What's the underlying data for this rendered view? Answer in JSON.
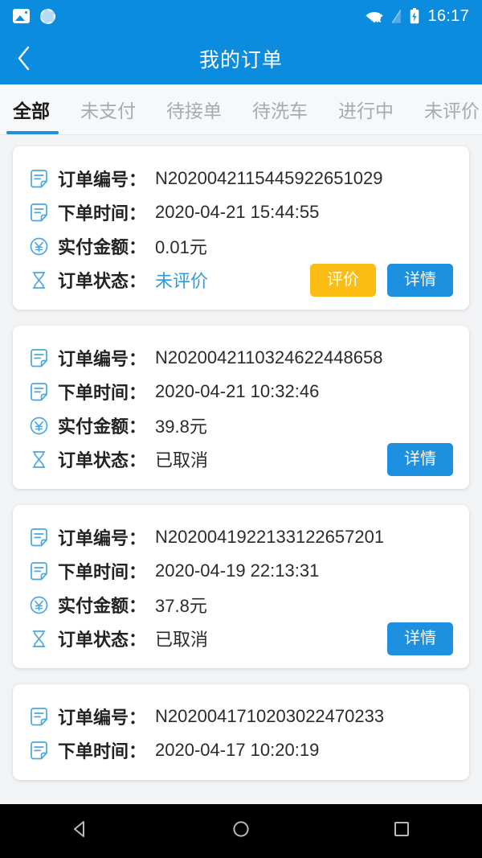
{
  "statusbar": {
    "time": "16:17",
    "icons": [
      "photo-icon",
      "sync-icon",
      "wifi-disconnected-icon",
      "sim-card-icon",
      "battery-charging-icon"
    ]
  },
  "header": {
    "title": "我的订单",
    "back_icon": "chevron-left-icon",
    "background": "#0c8cdf"
  },
  "tabs": [
    {
      "label": "全部",
      "active": true
    },
    {
      "label": "未支付",
      "active": false
    },
    {
      "label": "待接单",
      "active": false
    },
    {
      "label": "待洗车",
      "active": false
    },
    {
      "label": "进行中",
      "active": false
    },
    {
      "label": "未评价",
      "active": false
    }
  ],
  "labels": {
    "order_no": "订单编号：",
    "order_time": "下单时间：",
    "paid_amount": "实付金额：",
    "order_status": "订单状态："
  },
  "buttons": {
    "review": "评价",
    "detail": "详情",
    "review_color": "#fbbd14",
    "detail_color": "#1e90e0"
  },
  "orders": [
    {
      "order_no": "N202004211544 5922651029",
      "order_no_text": "N20200421154459 22651029",
      "no": "N202004211544592 2651029",
      "number": "N202004211544 5922651029",
      "value_no": "N20200421154459 22651029",
      "display_no": "N2020042115445922651029",
      "time": "2020-04-21 15:44:55",
      "amount": "0.01元",
      "status": "未评价",
      "status_is_link": true,
      "has_review": true,
      "has_detail": true,
      "partial": false
    },
    {
      "display_no": "N2020042110324622448658",
      "time": "2020-04-21 10:32:46",
      "amount": "39.8元",
      "status": "已取消",
      "status_is_link": false,
      "has_review": false,
      "has_detail": true,
      "partial": false
    },
    {
      "display_no": "N2020041922133122657201",
      "time": "2020-04-19 22:13:31",
      "amount": "37.8元",
      "status": "已取消",
      "status_is_link": false,
      "has_review": false,
      "has_detail": true,
      "partial": false
    },
    {
      "display_no": "N2020041710203022470233",
      "time": "2020-04-17 10:20:19",
      "amount": "",
      "status": "",
      "status_is_link": false,
      "has_review": false,
      "has_detail": false,
      "partial": true
    }
  ],
  "navbar": {
    "back": "back-triangle-icon",
    "home": "home-circle-icon",
    "recents": "recents-square-icon"
  },
  "colors": {
    "primary": "#0c8cdf",
    "accent_link": "#2f9ae0",
    "page_bg": "#f2f3f5",
    "card_bg": "#ffffff"
  }
}
